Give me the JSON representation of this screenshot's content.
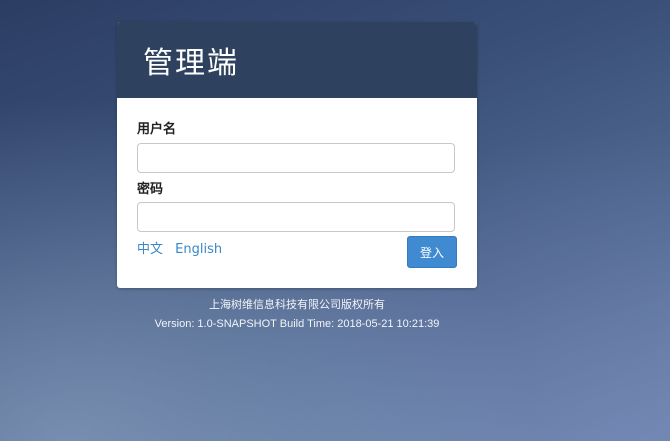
{
  "login_card": {
    "title": "管理端",
    "username_label": "用户名",
    "username_value": "",
    "password_label": "密码",
    "password_value": "",
    "lang_chinese": "中文",
    "lang_english": "English",
    "login_button": "登入"
  },
  "footer": {
    "copyright": "上海树维信息科技有限公司版权所有",
    "version": "Version: 1.0-SNAPSHOT Build Time: 2018-05-21 10:21:39"
  },
  "colors": {
    "header_bg": "#2e4260",
    "link": "#3a87c9",
    "button_bg": "#3f8ad0"
  }
}
